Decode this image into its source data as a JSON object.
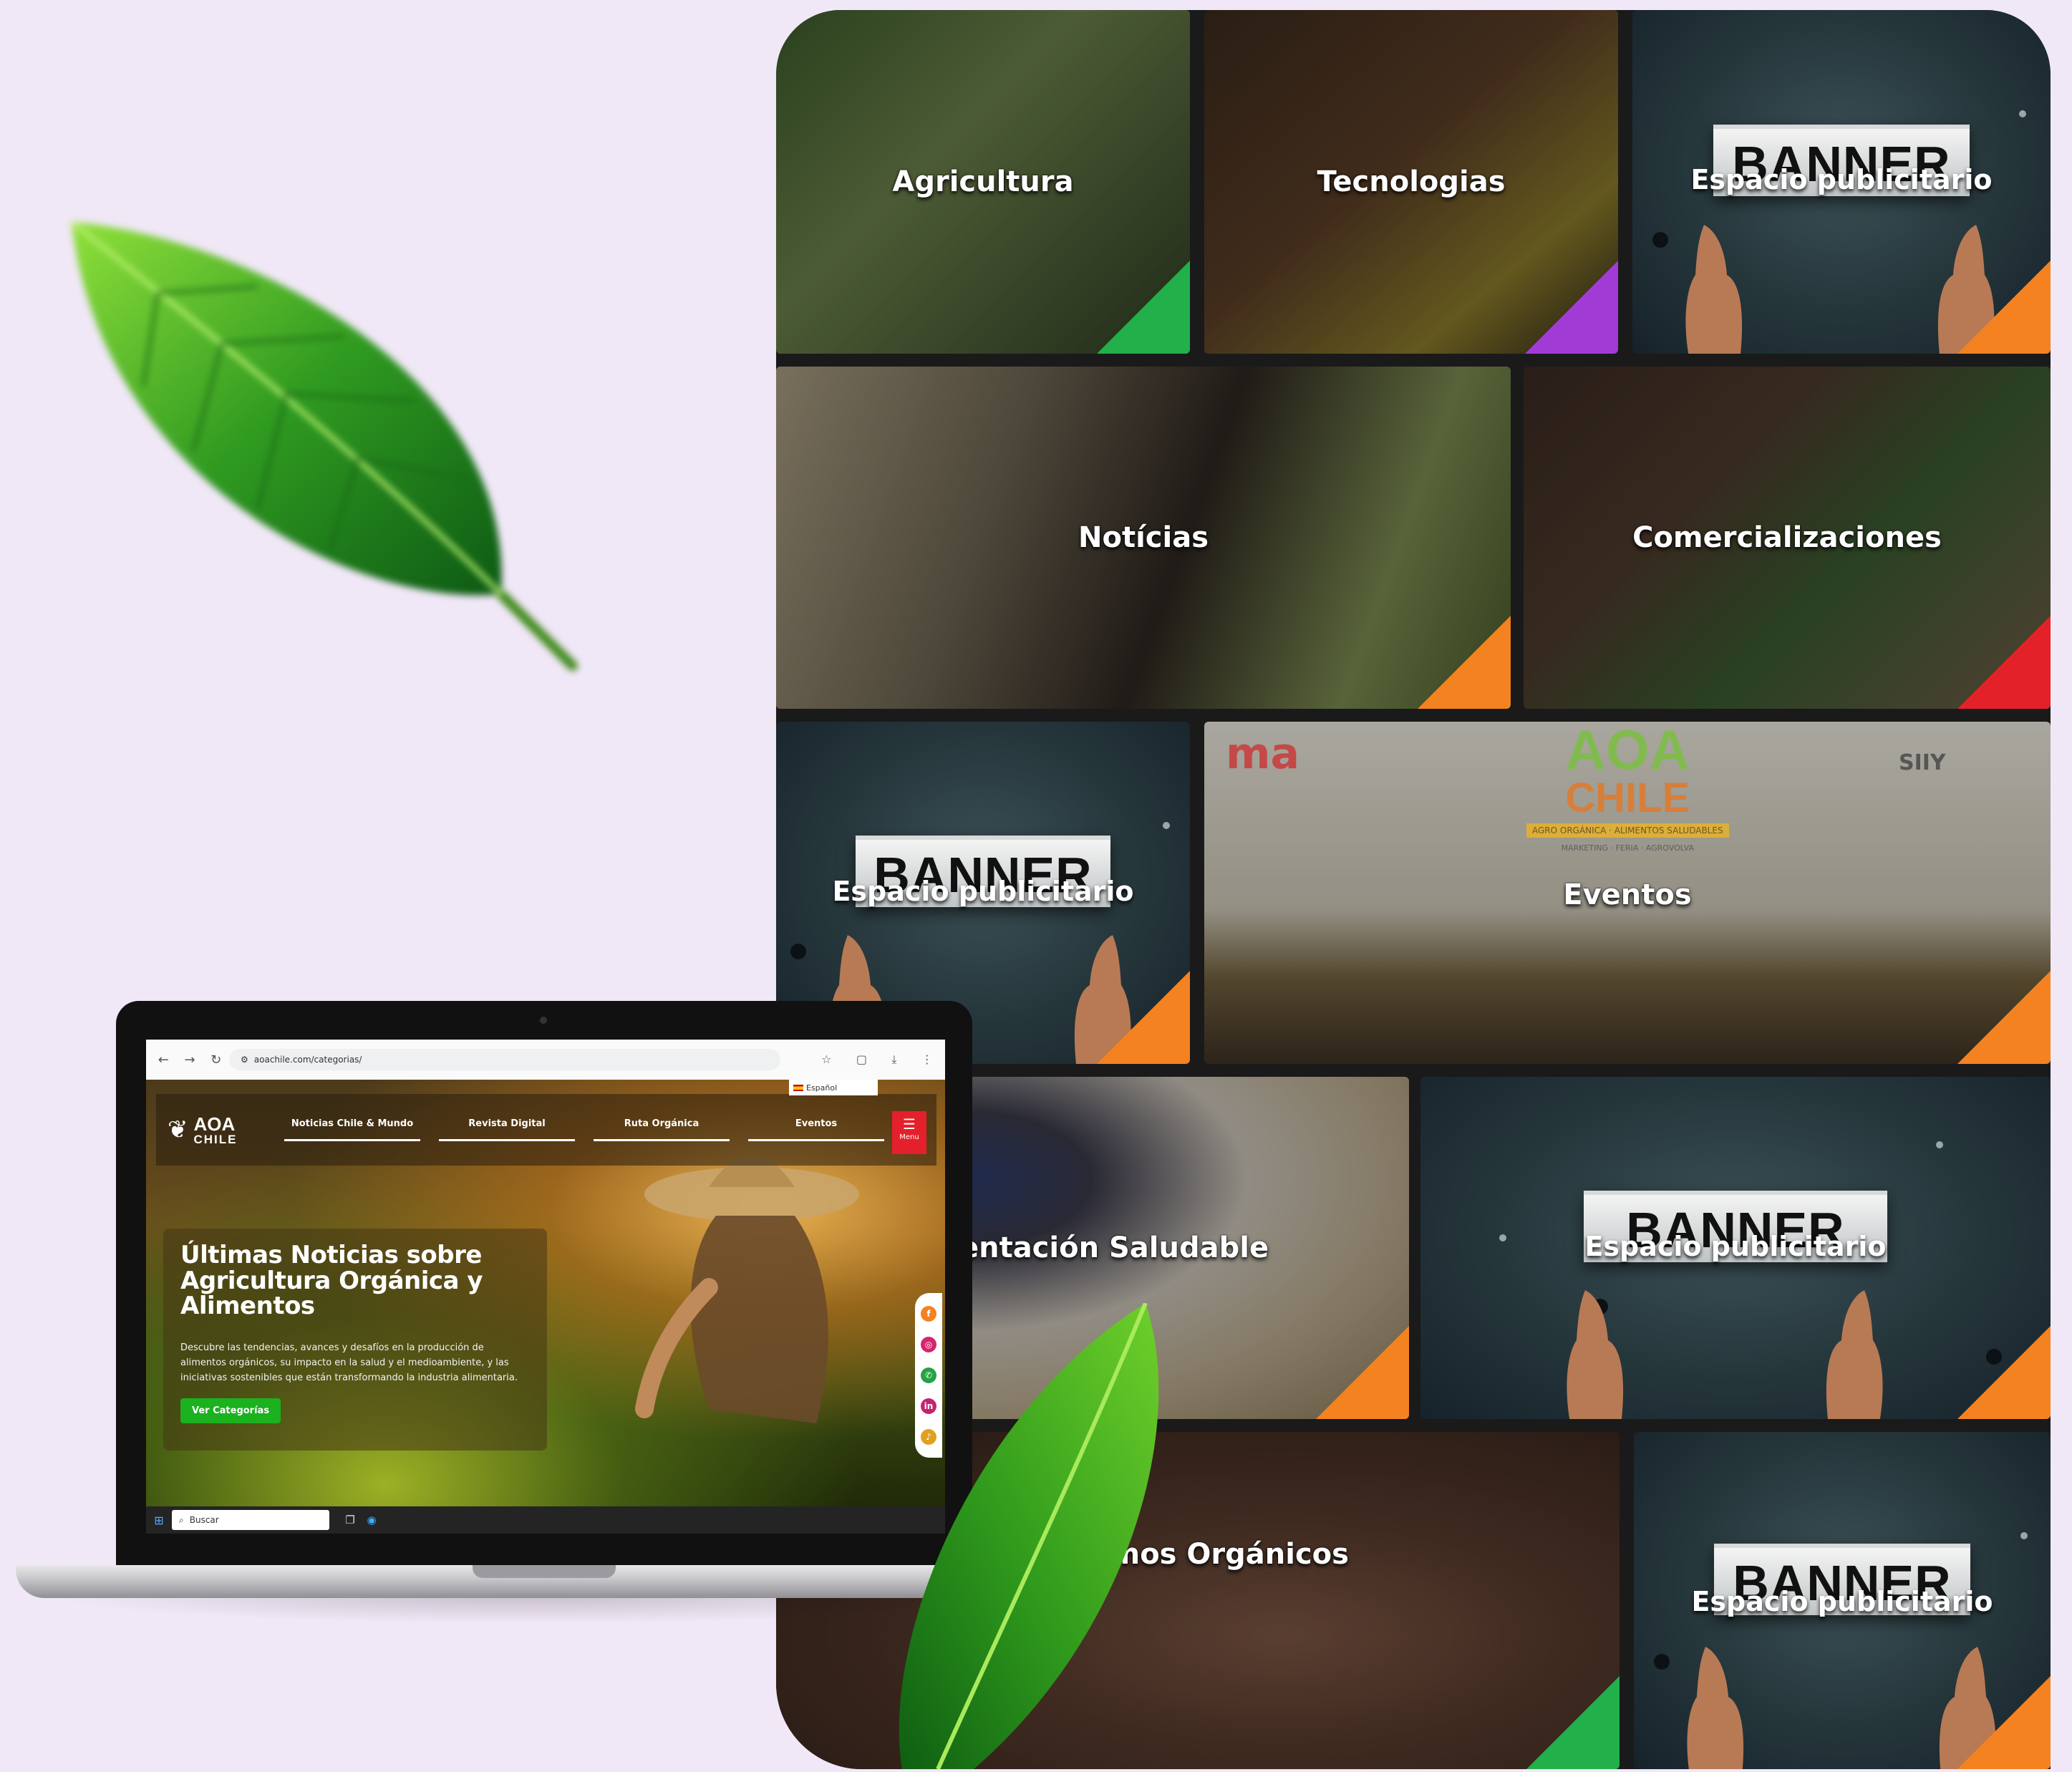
{
  "tiles": {
    "agricultura": "Agricultura",
    "tecnologias": "Tecnologias",
    "noticias": "Notícias",
    "comercializaciones": "Comercializaciones",
    "eventos": "Eventos",
    "alimentacion": "Alimentación Saludable",
    "insumos": "umos Orgánicos"
  },
  "banner": {
    "title": "BANNER",
    "subtitle": "Espacio publicitario"
  },
  "eventos_sign": {
    "brand1": "AOA",
    "brand2": "CHILE",
    "ribbon": "AGRO ORGÁNICA · ALIMENTOS SALUDABLES",
    "tagline": "MARKETING · FERIA · AGROVOLVA",
    "logo_left": "ma",
    "logo_right": "SIIY"
  },
  "browser": {
    "url": "aoachile.com/categorias/"
  },
  "site": {
    "language": "Español",
    "logo_line1": "AOA",
    "logo_line2": "CHILE",
    "nav": [
      "Noticias Chile & Mundo",
      "Revista Digital",
      "Ruta Orgánica",
      "Eventos"
    ],
    "menu_label": "Menu",
    "hero_title": "Últimas Noticias sobre Agricultura Orgánica y Alimentos",
    "hero_text": "Descubre las tendencias, avances y desafíos en la producción de alimentos orgánicos, su impacto en la salud y el medioambiente, y las iniciativas sostenibles que están transformando la industria alimentaria.",
    "cta": "Ver Categorías"
  },
  "taskbar": {
    "search_placeholder": "Buscar"
  },
  "colors": {
    "background": "#f1e8f7",
    "accent_green": "#1bb11f",
    "accent_red": "#e3202b",
    "corner_green": "#22b04a",
    "corner_purple": "#a23bd6",
    "corner_orange": "#f58220",
    "corner_red": "#e32129"
  }
}
